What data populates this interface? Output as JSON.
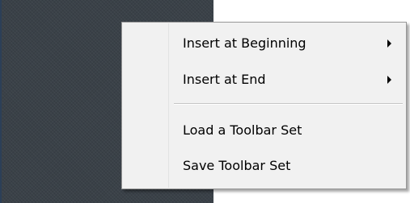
{
  "context_menu": {
    "items": [
      {
        "label": "Insert at Beginning",
        "submenu": true
      },
      {
        "label": "Insert at End",
        "submenu": true
      },
      {
        "label": "Load a Toolbar Set",
        "submenu": false
      },
      {
        "label": "Save Toolbar Set",
        "submenu": false
      }
    ],
    "submenu_icon": "chevron-right-icon"
  },
  "colors": {
    "desktop": "#3a4148",
    "menu_bg": "#f1f1f1",
    "menu_border": "#979797",
    "separator": "#c5c5c5",
    "text": "#000000"
  }
}
